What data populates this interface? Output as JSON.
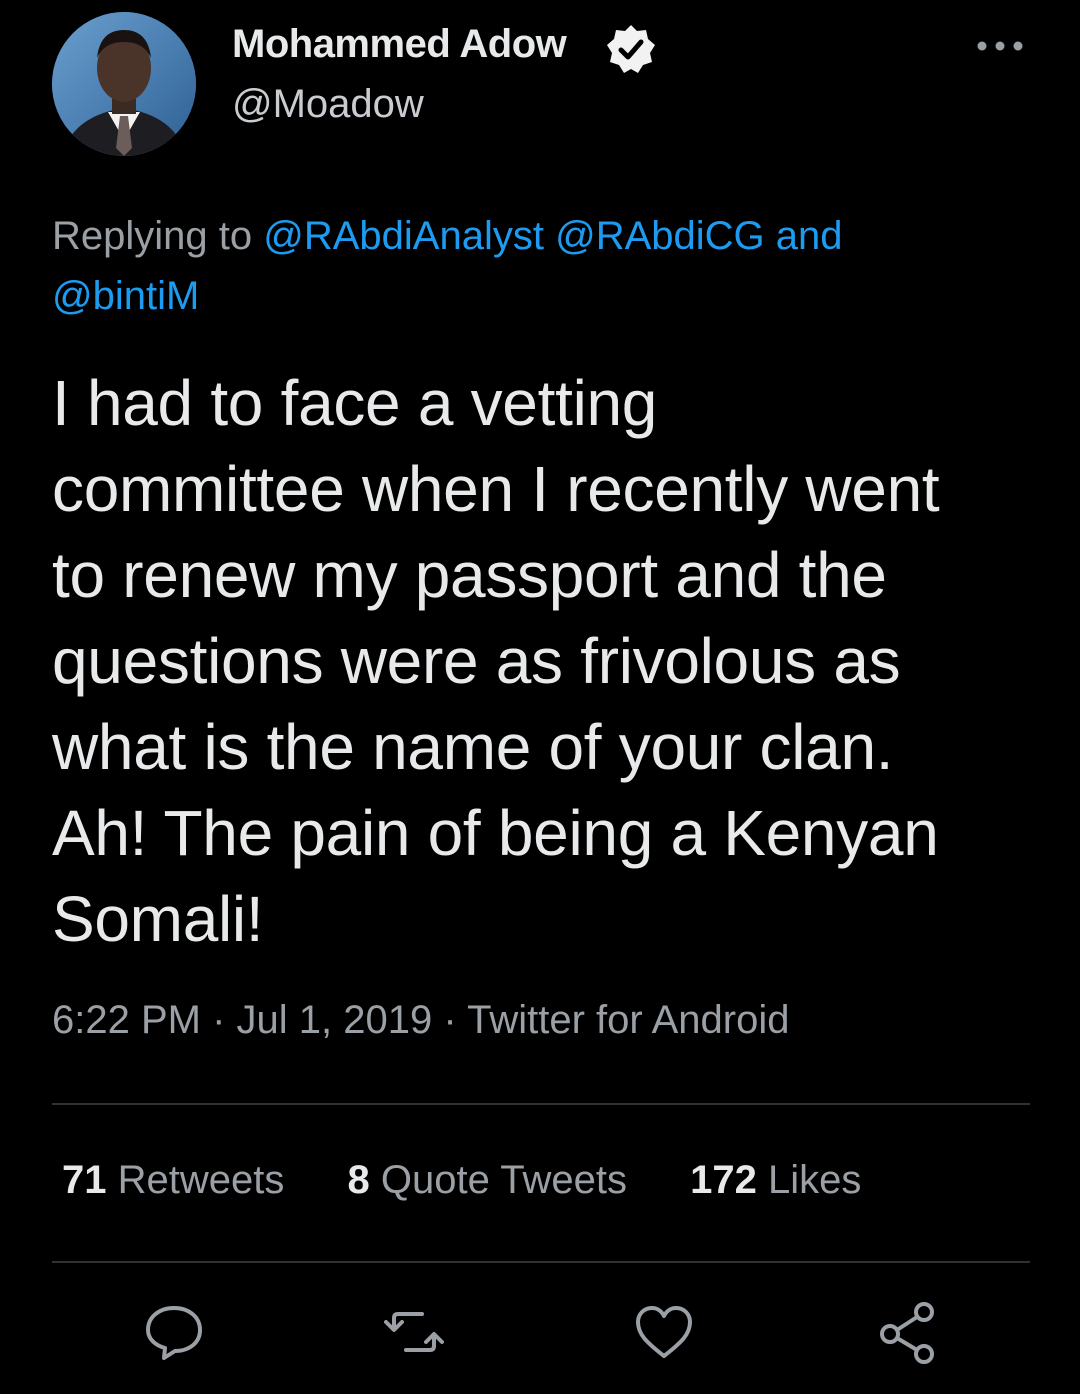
{
  "author": {
    "display_name": "Mohammed Adow",
    "handle": "@Moadow",
    "verified": true
  },
  "reply": {
    "prefix": "Replying to",
    "mentions": [
      "@RAbdiAnalyst",
      "@RAbdiCG"
    ],
    "and_word": "and",
    "last_mention": "@bintiM"
  },
  "tweet": {
    "text": "I had to face a vetting\ncommittee when I recently went\nto renew my passport and the\nquestions were as frivolous as\nwhat is the name of your clan.\nAh! The pain of being a Kenyan\nSomali!",
    "time": "6:22 PM",
    "date": "Jul 1, 2019",
    "source": "Twitter for Android",
    "separator": "·"
  },
  "stats": {
    "retweets_count": "71",
    "retweets_label": "Retweets",
    "quotes_count": "8",
    "quotes_label": "Quote Tweets",
    "likes_count": "172",
    "likes_label": "Likes"
  },
  "actions": {
    "reply_icon": "speech-bubble",
    "retweet_icon": "retweet-arrows",
    "like_icon": "heart",
    "share_icon": "share-nodes"
  },
  "colors": {
    "background": "#000000",
    "text": "#e7e9ea",
    "secondary": "#9aa0a6",
    "link": "#1d9bf0"
  }
}
